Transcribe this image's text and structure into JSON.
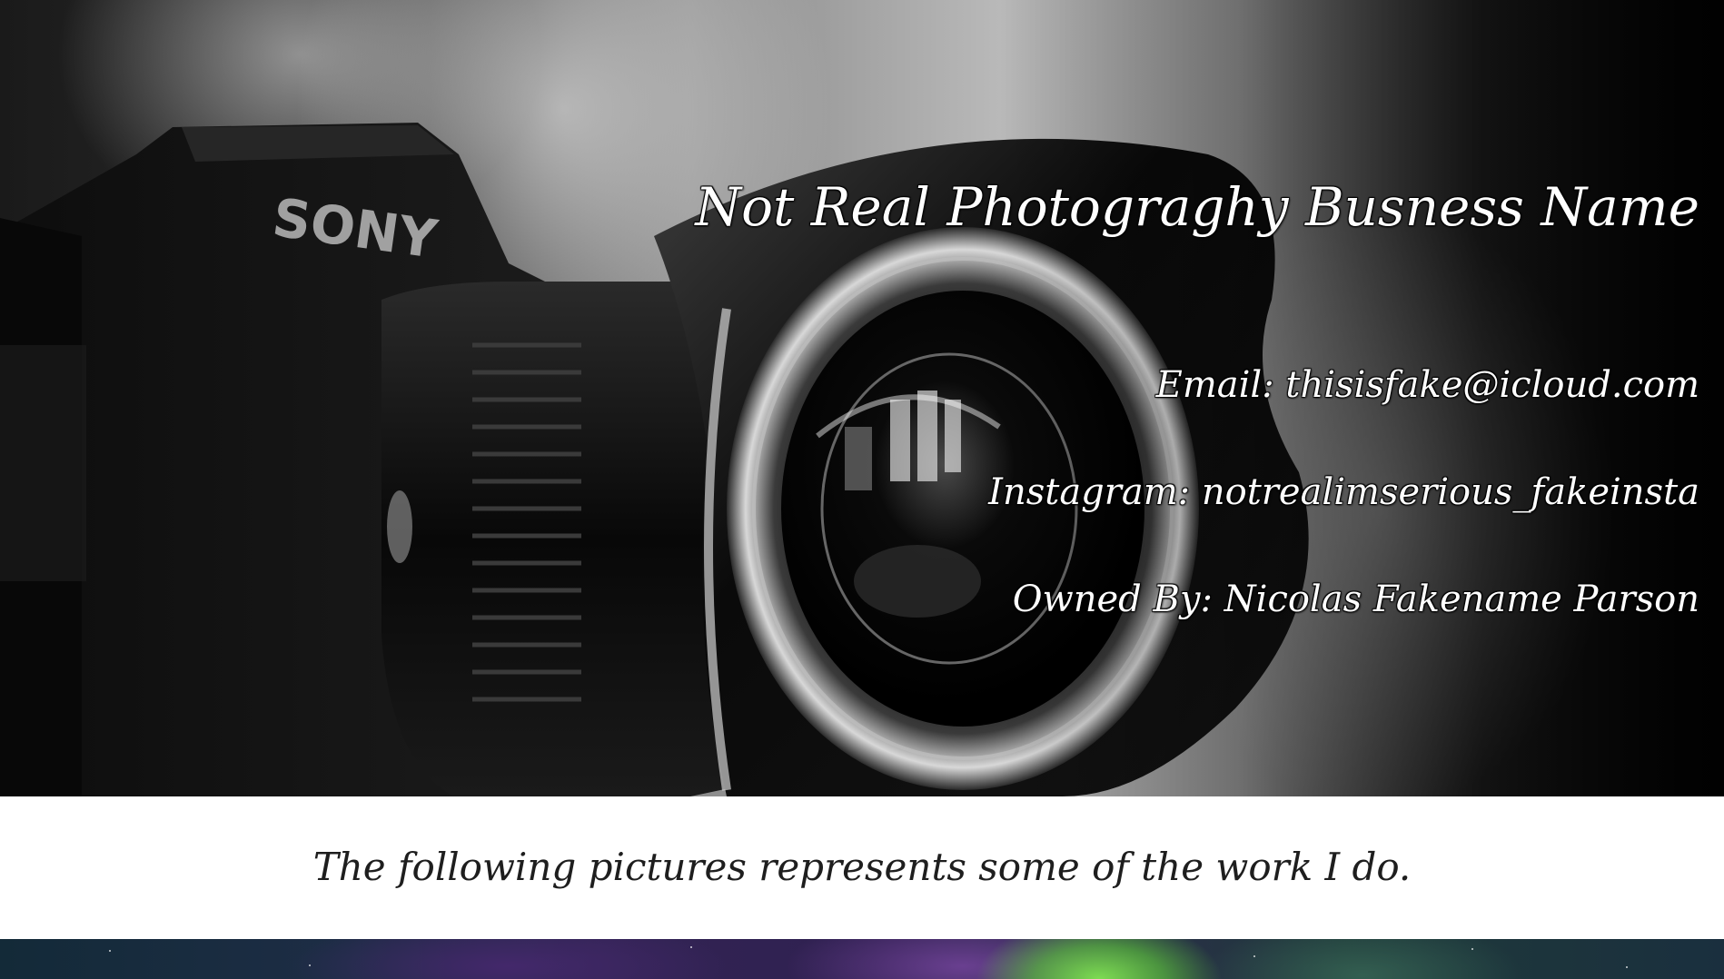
{
  "hero": {
    "title": "Not Real Photograghy Busness Name",
    "email": "Email: thisisfake@icloud.com",
    "instagram": "Instagram: notrealimserious_fakeinsta",
    "owner": "Owned By: Nicolas Fakename Parson",
    "background_image": "camera-lens-photo",
    "camera_brand_text": "SONY"
  },
  "intro": {
    "text": "The following pictures represents some of the work I do."
  },
  "gallery": {
    "preview_image": "aurora-night-sky-photo"
  }
}
